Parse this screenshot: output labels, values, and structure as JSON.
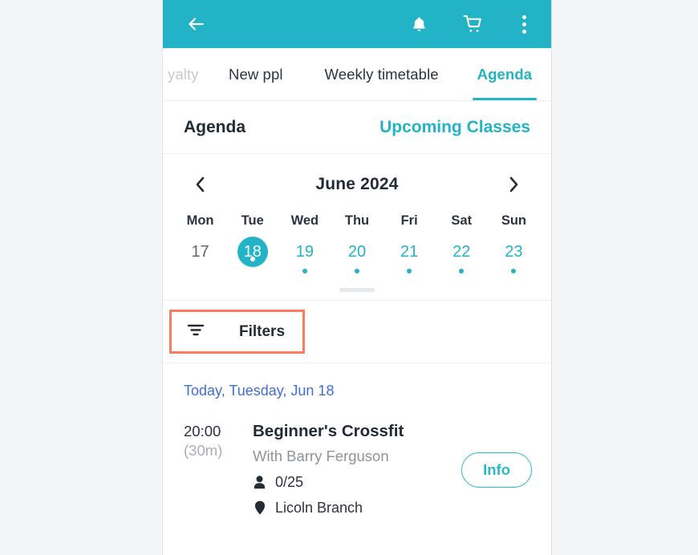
{
  "theme": {
    "accent_teal": "#22b3c6",
    "link_blue": "#3f6fd6",
    "highlight_coral": "#fb7b5e",
    "text_dark": "#222b36",
    "text_muted": "#8d949b",
    "page_background": "#f4f5f6"
  },
  "appbar": {
    "back_icon": "back-arrow-icon",
    "bell_icon": "bell-icon",
    "cart_icon": "shopping-cart-icon",
    "overflow_icon": "more-vertical-icon"
  },
  "tabs": [
    {
      "label": "yalty",
      "state": "partial"
    },
    {
      "label": "New ppl",
      "state": "inactive"
    },
    {
      "label": "Weekly timetable",
      "state": "inactive"
    },
    {
      "label": "Agenda",
      "state": "active"
    }
  ],
  "agenda_header": {
    "title": "Agenda",
    "upcoming_link": "Upcoming Classes"
  },
  "calendar": {
    "prev_icon": "chevron-left-icon",
    "next_icon": "chevron-right-icon",
    "month_label": "June 2024",
    "weekdays": [
      "Mon",
      "Tue",
      "Wed",
      "Thu",
      "Fri",
      "Sat",
      "Sun"
    ],
    "days": [
      {
        "num": "17",
        "state": "past",
        "dot": false
      },
      {
        "num": "18",
        "state": "selected",
        "dot": true
      },
      {
        "num": "19",
        "state": "avail",
        "dot": true
      },
      {
        "num": "20",
        "state": "avail",
        "dot": true
      },
      {
        "num": "21",
        "state": "avail",
        "dot": true
      },
      {
        "num": "22",
        "state": "avail",
        "dot": true
      },
      {
        "num": "23",
        "state": "avail",
        "dot": true
      }
    ]
  },
  "filters": {
    "label": "Filters",
    "icon": "filter-icon",
    "highlighted": true
  },
  "day_section": {
    "label": "Today, Tuesday, Jun 18",
    "classes": [
      {
        "time_start": "20:00",
        "duration": "(30m)",
        "title": "Beginner's Crossfit",
        "instructor": "With Barry Ferguson",
        "attendance": "0/25",
        "attendance_icon": "person-icon",
        "location": "Licoln Branch",
        "location_icon": "map-pin-icon",
        "action_label": "Info"
      }
    ]
  }
}
